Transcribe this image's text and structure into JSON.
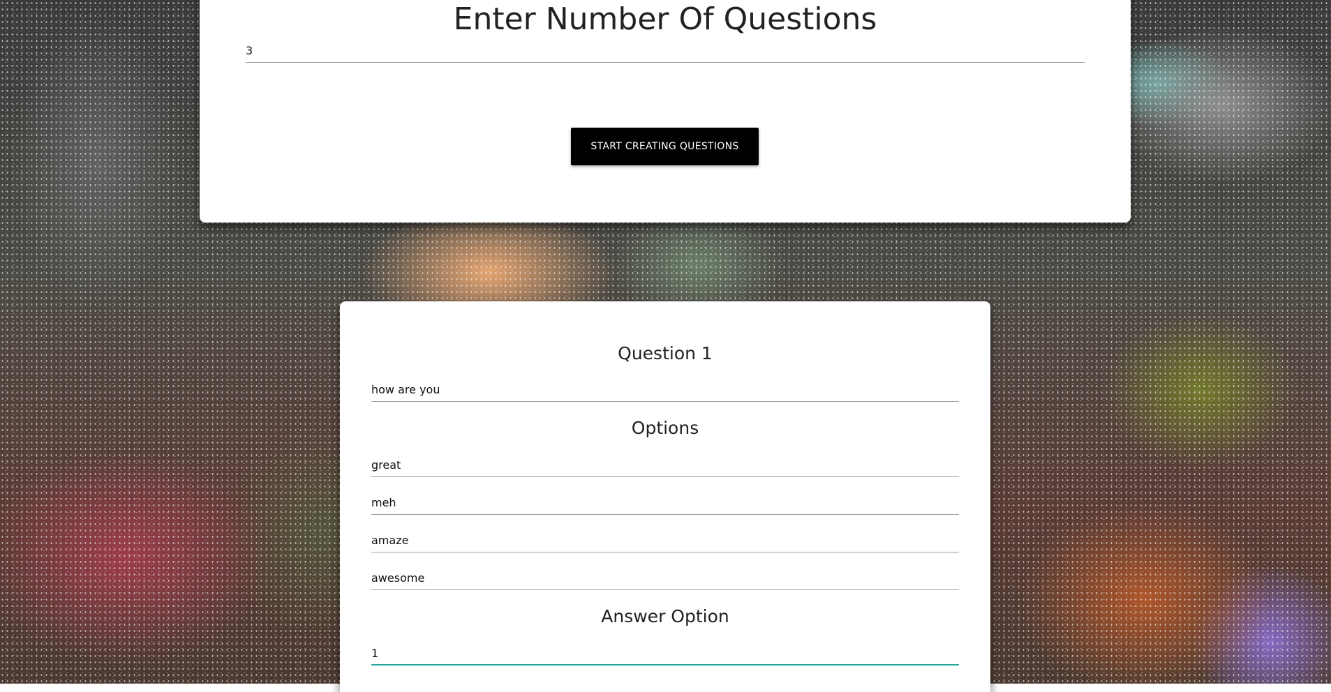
{
  "setup": {
    "title": "Enter Number Of Questions",
    "count_value": "3",
    "start_button": "START CREATING QUESTIONS"
  },
  "question": {
    "heading": "Question 1",
    "text_value": "how are you",
    "options_heading": "Options",
    "options": [
      "great",
      "meh",
      "amaze",
      "awesome"
    ],
    "answer_heading": "Answer Option",
    "answer_value": "1"
  },
  "colors": {
    "button_bg": "#000000",
    "active_underline": "#26a69a",
    "card_bg": "#ffffff"
  }
}
